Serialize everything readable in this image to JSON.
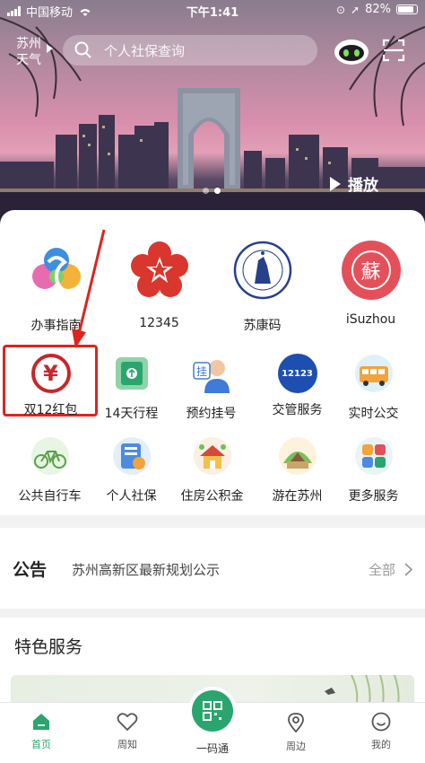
{
  "status": {
    "carrier": "中国移动",
    "time": "下午1:41",
    "battery": "82%"
  },
  "header": {
    "weather_city": "苏州",
    "weather_label": "天气",
    "search_placeholder": "个人社保查询",
    "play_label": "播放"
  },
  "services_top": [
    {
      "label": "办事指南",
      "icon": "service-guide-icon"
    },
    {
      "label": "12345",
      "icon": "hotline-12345-icon"
    },
    {
      "label": "苏康码",
      "icon": "health-code-icon"
    },
    {
      "label": "iSuzhou",
      "icon": "isuzhou-icon",
      "glyph": "蘇"
    }
  ],
  "services_row2": [
    {
      "label": "双12红包",
      "icon": "digital-yuan-icon",
      "glyph": "¥"
    },
    {
      "label": "14天行程",
      "icon": "itinerary-icon"
    },
    {
      "label": "预约挂号",
      "icon": "doctor-appointment-icon",
      "glyph": "挂"
    },
    {
      "label": "交管服务",
      "icon": "traffic-12123-icon",
      "glyph": "12123"
    },
    {
      "label": "实时公交",
      "icon": "bus-icon"
    }
  ],
  "services_row3": [
    {
      "label": "公共自行车",
      "icon": "bicycle-icon"
    },
    {
      "label": "个人社保",
      "icon": "social-security-icon"
    },
    {
      "label": "住房公积金",
      "icon": "housing-fund-icon"
    },
    {
      "label": "游在苏州",
      "icon": "tourism-icon"
    },
    {
      "label": "更多服务",
      "icon": "more-services-icon"
    }
  ],
  "notice": {
    "tag": "公告",
    "text": "苏州高新区最新规划公示",
    "more": "全部"
  },
  "featured": {
    "title": "特色服务"
  },
  "tabbar": {
    "home": "首页",
    "weekly": "周知",
    "code": "一码通",
    "nearby": "周边",
    "mine": "我的"
  },
  "colors": {
    "accent": "#2aa56e",
    "highlight": "#e0231e"
  }
}
